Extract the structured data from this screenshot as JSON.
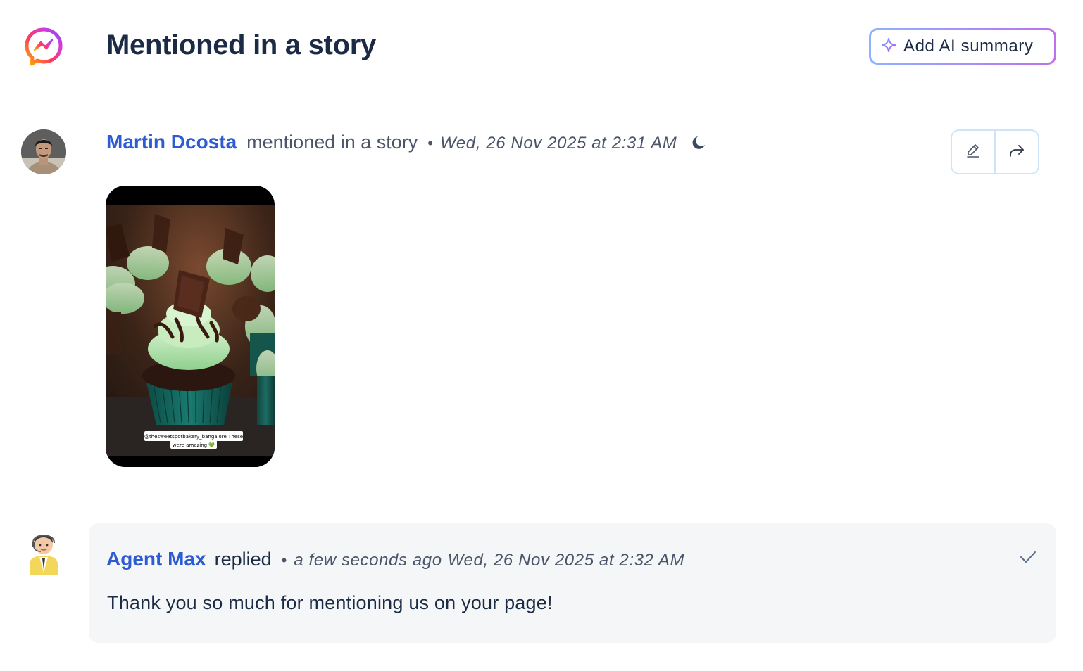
{
  "header": {
    "title": "Mentioned in a story",
    "ai_button_label": "Add AI summary",
    "logo_icon": "messenger-logo-icon"
  },
  "story_message": {
    "author": "Martin Dcosta",
    "action": "mentioned in a story",
    "separator": "•",
    "timestamp": "Wed, 26 Nov 2025 at 2:31 AM",
    "status_icon": "moon-icon",
    "actions": [
      "edit-icon",
      "share-forward-icon"
    ],
    "story_caption_line1": "@thesweetspotbakery_bangalore These",
    "story_caption_line2": "were amazing 💚"
  },
  "reply": {
    "author": "Agent Max",
    "action": "replied",
    "separator": "•",
    "relative_time": "a few seconds ago",
    "timestamp": "Wed, 26 Nov 2025 at 2:32 AM",
    "text": "Thank you so much for mentioning us on your page!",
    "status_icon": "check-icon"
  },
  "colors": {
    "author_link": "#2d5bd1",
    "title": "#1b2b45",
    "reply_bg": "#f4f6f8",
    "action_border": "#cfe4fb"
  }
}
